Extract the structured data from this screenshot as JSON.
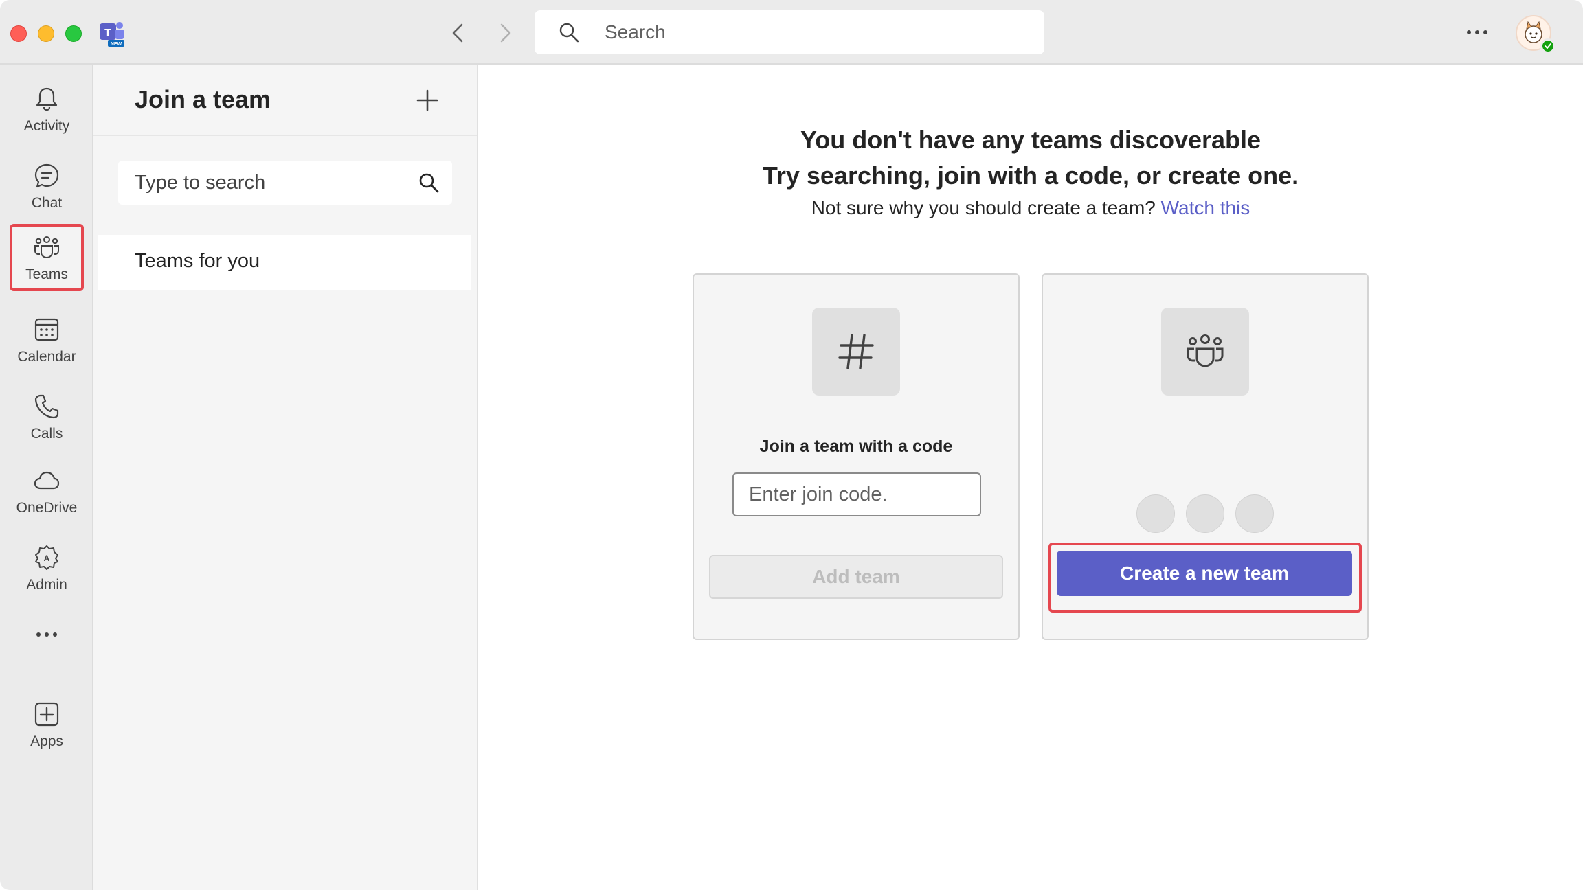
{
  "titlebar": {
    "search_placeholder": "Search",
    "app_badge": "NEW"
  },
  "rail": {
    "items": [
      {
        "label": "Activity",
        "icon": "bell-icon"
      },
      {
        "label": "Chat",
        "icon": "chat-icon"
      },
      {
        "label": "Teams",
        "icon": "teams-icon",
        "active": true
      },
      {
        "label": "Calendar",
        "icon": "calendar-icon"
      },
      {
        "label": "Calls",
        "icon": "phone-icon"
      },
      {
        "label": "OneDrive",
        "icon": "cloud-icon"
      },
      {
        "label": "Admin",
        "icon": "admin-icon"
      },
      {
        "label": "",
        "icon": "more-icon"
      },
      {
        "label": "Apps",
        "icon": "add-app-icon"
      }
    ]
  },
  "panel": {
    "title": "Join a team",
    "search_placeholder": "Type to search",
    "list": [
      "Teams for you"
    ]
  },
  "main": {
    "heading_line1": "You don't have any teams discoverable",
    "heading_line2": "Try searching, join with a code, or create one.",
    "subtext": "Not sure why you should create a team?",
    "link": "Watch this",
    "join_card": {
      "heading": "Join a team with a code",
      "input_placeholder": "Enter join code.",
      "button": "Add team"
    },
    "create_card": {
      "button": "Create a new team"
    }
  },
  "colors": {
    "accent": "#5b5fc7",
    "highlight": "#e5474f",
    "status": "#13a10e"
  }
}
